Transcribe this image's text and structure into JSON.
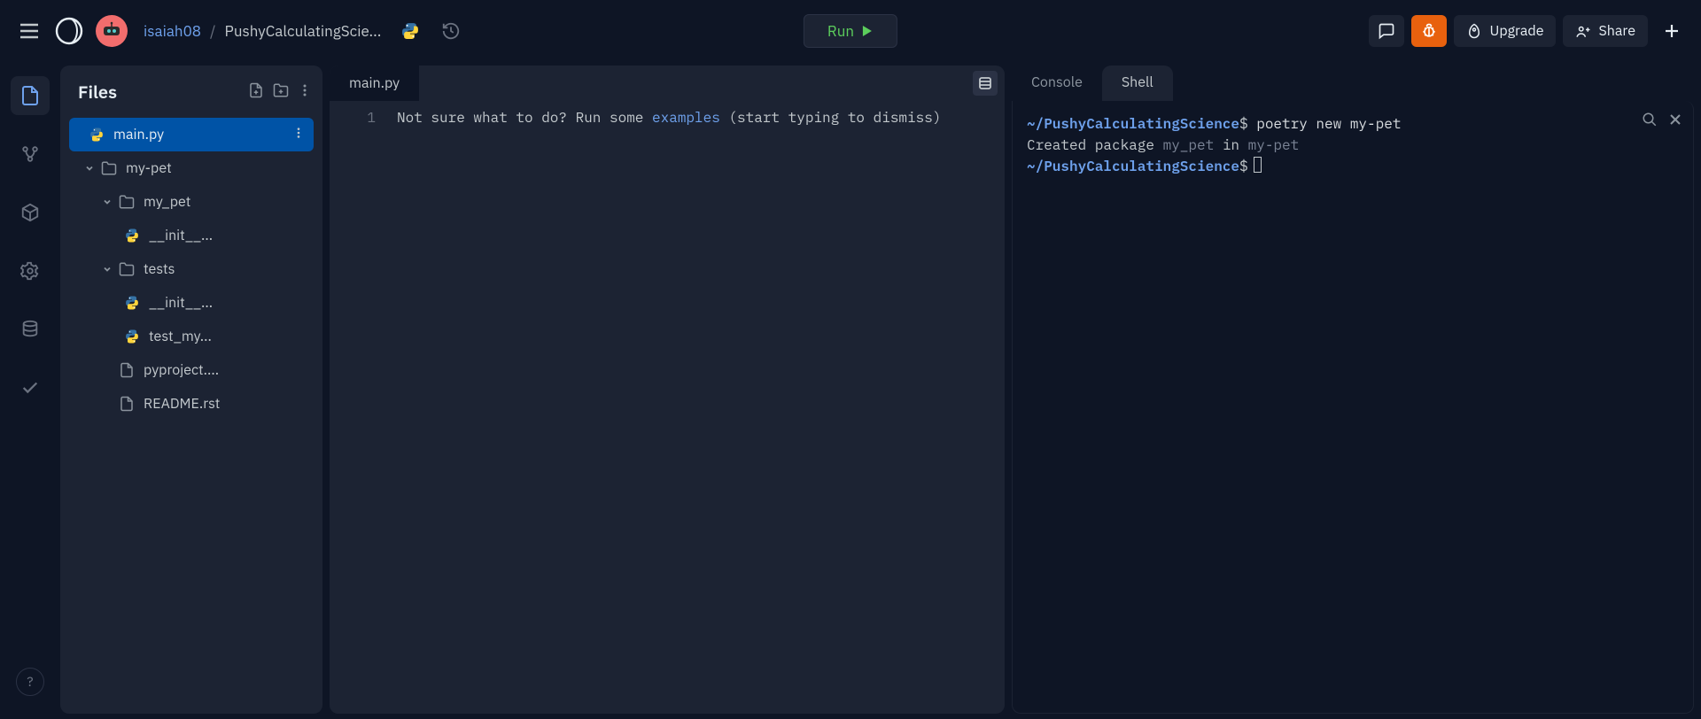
{
  "header": {
    "user": "isaiah08",
    "separator": "/",
    "project": "PushyCalculatingScie...",
    "run_label": "Run",
    "upgrade_label": "Upgrade",
    "share_label": "Share"
  },
  "sidebar": {
    "title": "Files",
    "tree": [
      {
        "label": "main.py",
        "type": "python",
        "indent": 0,
        "selected": true,
        "dots": true
      },
      {
        "label": "my-pet",
        "type": "folder",
        "indent": 1,
        "chevron": "down"
      },
      {
        "label": "my_pet",
        "type": "folder",
        "indent": 2,
        "chevron": "down"
      },
      {
        "label": "__init__...",
        "type": "python",
        "indent": 3
      },
      {
        "label": "tests",
        "type": "folder",
        "indent": 2,
        "chevron": "down"
      },
      {
        "label": "__init__...",
        "type": "python",
        "indent": 3
      },
      {
        "label": "test_my...",
        "type": "python",
        "indent": 3
      },
      {
        "label": "pyproject....",
        "type": "file",
        "indent": 2
      },
      {
        "label": "README.rst",
        "type": "file",
        "indent": 2
      }
    ]
  },
  "editor": {
    "tab_label": "main.py",
    "line_number": "1",
    "hint_prefix": "Not sure what to do? Run some ",
    "hint_link": "examples",
    "hint_suffix": " (start typing to dismiss)"
  },
  "console": {
    "tabs": {
      "console": "Console",
      "shell": "Shell"
    },
    "prompt_path": "~/PushyCalculatingScience",
    "prompt_char": "$",
    "command": "poetry new my-pet",
    "out_prefix": "Created package ",
    "out_pkg": "my_pet",
    "out_in": " in ",
    "out_dir": "my-pet"
  },
  "help_label": "?"
}
